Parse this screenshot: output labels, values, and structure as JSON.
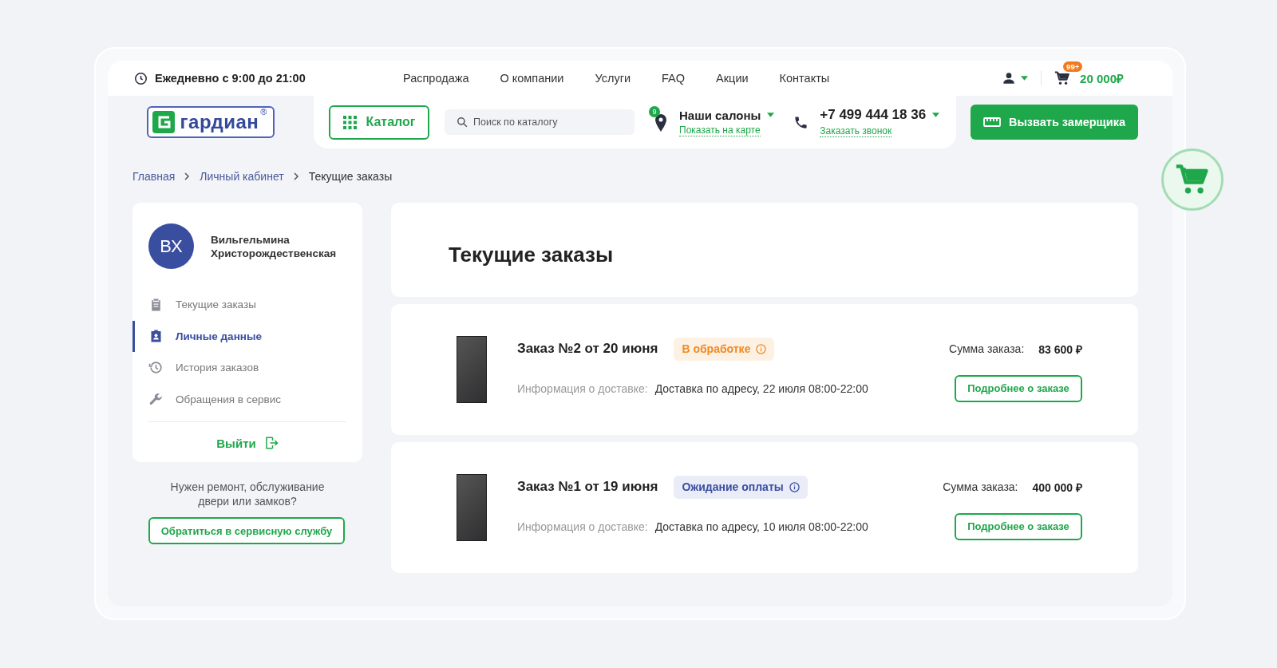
{
  "header": {
    "hours": "Ежедневно с 9:00 до 21:00",
    "nav": [
      "Распродажа",
      "О компании",
      "Услуги",
      "FAQ",
      "Акции",
      "Контакты"
    ],
    "cart_badge": "99+",
    "cart_total": "20 000₽",
    "logo": {
      "text": "гардиан",
      "mark": "®"
    },
    "catalog_button": "Каталог",
    "search": {
      "placeholder": "Поиск по каталогу"
    },
    "salons": {
      "badge": "9",
      "title": "Наши салоны",
      "link": "Показать на карте"
    },
    "phone": {
      "number": "+7 499 444 18 36",
      "link": "Заказать звонок"
    },
    "measure_button": "Вызвать замерщика"
  },
  "breadcrumbs": [
    "Главная",
    "Личный кабинет",
    "Текущие заказы"
  ],
  "profile": {
    "initials": "ВХ",
    "name": "Вильгельмина Христорождественская"
  },
  "menu": [
    {
      "label": "Текущие заказы",
      "selected": false
    },
    {
      "label": "Личные данные",
      "selected": true
    },
    {
      "label": "История заказов",
      "selected": false
    },
    {
      "label": "Обращения в сервис",
      "selected": false
    }
  ],
  "logout": "Выйти",
  "service_prompt": "Нужен ремонт, обслуживание двери или замков?",
  "service_button": "Обратиться в сервисную службу",
  "page_title": "Текущие заказы",
  "orders": [
    {
      "title": "Заказ №2 от 20 июня",
      "status": "В обработке",
      "kind": "processing",
      "sum_label": "Сумма заказа:",
      "sum": "83 600 ₽",
      "delivery_label": "Информация о доставке:",
      "delivery": "Доставка по адресу, 22 июля 08:00-22:00",
      "details_button": "Подробнее о заказе"
    },
    {
      "title": "Заказ №1 от 19 июня",
      "status": "Ожидание оплаты",
      "kind": "awaiting",
      "sum_label": "Сумма заказа:",
      "sum": "400 000 ₽",
      "delivery_label": "Информация о доставке:",
      "delivery": "Доставка по адресу, 10 июля 08:00-22:00",
      "details_button": "Подробнее о заказе"
    }
  ]
}
